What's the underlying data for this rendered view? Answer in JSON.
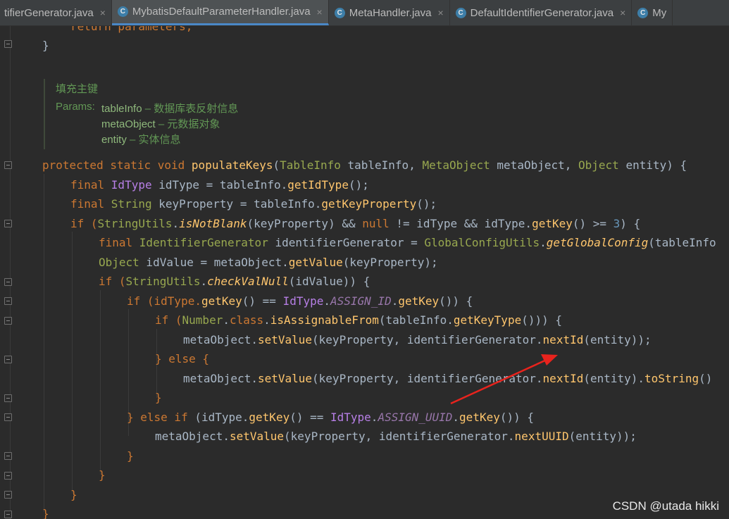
{
  "tabs": [
    {
      "label": "tifierGenerator.java",
      "icon": false
    },
    {
      "label": "MybatisDefaultParameterHandler.java",
      "icon": true
    },
    {
      "label": "MetaHandler.java",
      "icon": true
    },
    {
      "label": "DefaultIdentifierGenerator.java",
      "icon": true
    },
    {
      "label": "My",
      "icon": true
    }
  ],
  "tab_icon_glyph": "C",
  "tab_close_glyph": "×",
  "doc": {
    "title": "填充主键",
    "params_label": "Params:",
    "params": [
      {
        "name": "tableInfo",
        "desc": " – 数据库表反射信息"
      },
      {
        "name": "metaObject",
        "desc": " – 元数据对象"
      },
      {
        "name": "entity",
        "desc": " – 实体信息"
      }
    ]
  },
  "code": {
    "l0": [
      "return parameters;"
    ],
    "l1": [
      "}"
    ],
    "l2": [
      "protected static void ",
      "populateKeys",
      "(",
      "TableInfo",
      " tableInfo, ",
      "MetaObject",
      " metaObject, ",
      "Object",
      " entity) {"
    ],
    "l3": [
      "final ",
      "IdType",
      " idType = tableInfo.",
      "getIdType",
      "();"
    ],
    "l4": [
      "final ",
      "String",
      " keyProperty = tableInfo.",
      "getKeyProperty",
      "();"
    ],
    "l5": [
      "if (",
      "StringUtils",
      ".",
      "isNotBlank",
      "(keyProperty) && ",
      "null",
      " != idType && idType.",
      "getKey",
      "() >= ",
      "3",
      ") {"
    ],
    "l6": [
      "final ",
      "IdentifierGenerator",
      " identifierGenerator = ",
      "GlobalConfigUtils",
      ".",
      "getGlobalConfig",
      "(tableInfo"
    ],
    "l7": [
      "Object",
      " idValue = metaObject.",
      "getValue",
      "(keyProperty);"
    ],
    "l8": [
      "if (",
      "StringUtils",
      ".",
      "checkValNull",
      "(idValue)) {"
    ],
    "l9": [
      "if (idType.",
      "getKey",
      "() == ",
      "IdType",
      ".",
      "ASSIGN_ID",
      ".",
      "getKey",
      "()) {"
    ],
    "l10": [
      "if (",
      "Number",
      ".",
      "class",
      ".",
      "isAssignableFrom",
      "(tableInfo.",
      "getKeyType",
      "())) {"
    ],
    "l11": [
      "metaObject.",
      "setValue",
      "(keyProperty, identifierGenerator.",
      "nextId",
      "(entity));"
    ],
    "l12": [
      "} ",
      "else",
      " {"
    ],
    "l13": [
      "metaObject.",
      "setValue",
      "(keyProperty, identifierGenerator.",
      "nextId",
      "(entity).",
      "toString",
      "()"
    ],
    "l14": [
      "}"
    ],
    "l15": [
      "} ",
      "else if",
      " (idType.",
      "getKey",
      "() == ",
      "IdType",
      ".",
      "ASSIGN_UUID",
      ".",
      "getKey",
      "()) {"
    ],
    "l16": [
      "metaObject.",
      "setValue",
      "(keyProperty, identifierGenerator.",
      "nextUUID",
      "(entity));"
    ],
    "l17": [
      "}"
    ],
    "l18": [
      "}"
    ],
    "l19": [
      "}"
    ],
    "l20": [
      "}"
    ]
  },
  "watermark": "CSDN @utada hikki",
  "colors": {
    "background": "#2b2b2b",
    "keyword": "#cc7832",
    "type": "#98a84f",
    "method": "#ffc66d",
    "enum_constant": "#9876aa",
    "comment": "#629755",
    "arrow": "#e8231d"
  }
}
